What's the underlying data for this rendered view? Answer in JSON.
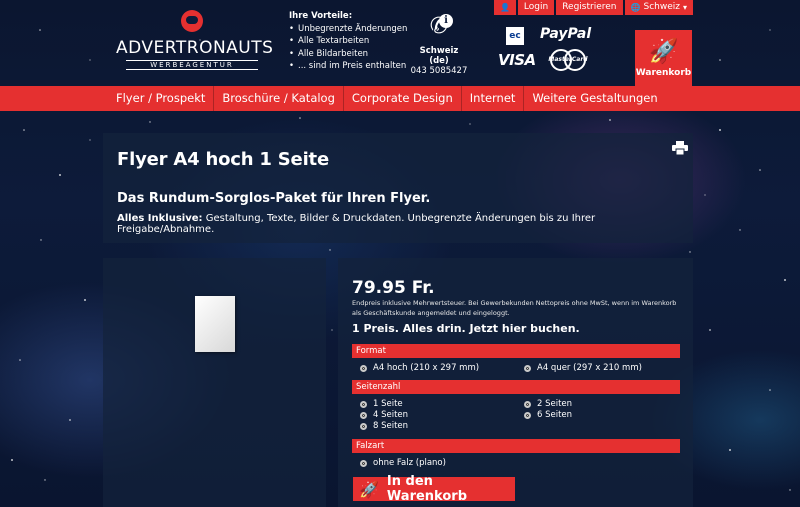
{
  "topbar": {
    "login": "Login",
    "register": "Registrieren",
    "country": "Schweiz"
  },
  "logo": {
    "name": "ADVERTRONAUTS",
    "tagline": "WERBEAGENTUR"
  },
  "vorteile": {
    "heading": "Ihre Vorteile:",
    "items": [
      "Unbegrenzte Änderungen",
      "Alle Textarbeiten",
      "Alle Bildarbeiten",
      "... sind im Preis enthalten"
    ]
  },
  "contact": {
    "country": "Schweiz (de)",
    "phone": "043 5085427"
  },
  "payments": {
    "ec": "ec",
    "paypal": "PayPal",
    "visa": "VISA",
    "mastercard": "MasterCard"
  },
  "cart": {
    "label": "Warenkorb"
  },
  "nav": {
    "items": [
      "Flyer / Prospekt",
      "Broschüre / Katalog",
      "Corporate Design",
      "Internet",
      "Weitere Gestaltungen"
    ]
  },
  "product": {
    "title": "Flyer A4 hoch 1 Seite",
    "subtitle": "Das Rundum-Sorglos-Paket für Ihren Flyer.",
    "inclusive_label": "Alles Inklusive:",
    "inclusive_text": " Gestaltung, Texte, Bilder & Druckdaten. Unbegrenzte Änderungen bis zu Ihrer Freigabe/Abnahme."
  },
  "order": {
    "price": "79.95 Fr.",
    "price_note": "Endpreis inklusive Mehrwertsteuer. Bei Gewerbekunden Nettopreis ohne MwSt, wenn im Warenkorb als Geschäftskunde angemeldet und eingeloggt.",
    "claim": "1 Preis. Alles drin. Jetzt hier buchen.",
    "format_label": "Format",
    "format_options": [
      "A4 hoch (210 x 297 mm)",
      "A4 quer (297 x 210 mm)"
    ],
    "pages_label": "Seitenzahl",
    "pages_options": [
      "1 Seite",
      "2 Seiten",
      "4 Seiten",
      "6 Seiten",
      "8 Seiten"
    ],
    "fold_label": "Falzart",
    "fold_options": [
      "ohne Falz (plano)"
    ],
    "button_label": "In den Warenkorb"
  },
  "icons": {
    "cart": "rocket-icon",
    "printer": "printer-icon",
    "phone": "phone-icon"
  },
  "colors": {
    "accent": "#e53030",
    "panel": "#14233c"
  }
}
